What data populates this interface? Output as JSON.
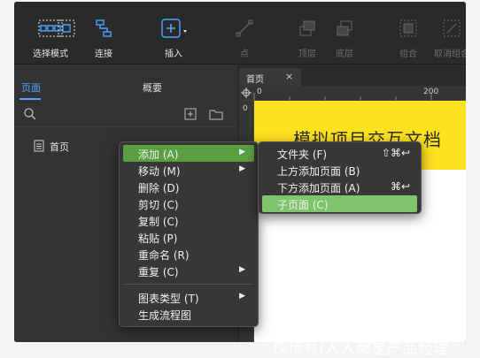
{
  "toolbar": {
    "select_mode": "选择模式",
    "connect": "连接",
    "insert": "插入",
    "point": "点",
    "top_layer": "顶层",
    "bottom_layer": "底层",
    "group": "组合",
    "ungroup": "取消组合"
  },
  "left_panel": {
    "tab_pages": "页面",
    "tab_overview": "概要",
    "page_item": "首页"
  },
  "canvas": {
    "tab_title": "首页",
    "tab_close": "×",
    "ruler_h_0": "0",
    "ruler_h_200": "200",
    "ruler_v_0": "0",
    "banner_title": "模拟项目交互文档"
  },
  "context_menu": {
    "items": [
      {
        "label": "添加 (A)"
      },
      {
        "label": "移动 (M)"
      },
      {
        "label": "删除 (D)"
      },
      {
        "label": "剪切 (C)"
      },
      {
        "label": "复制 (C)"
      },
      {
        "label": "粘贴 (P)"
      },
      {
        "label": "重命名 (R)"
      },
      {
        "label": "重复 (C)"
      },
      {
        "label": "图表类型 (T)"
      },
      {
        "label": "生成流程图"
      }
    ],
    "arrow": "▶"
  },
  "submenu": {
    "items": [
      {
        "label": "文件夹 (F)",
        "shortcut": "⇧⌘↩"
      },
      {
        "label": "上方添加页面 (B)",
        "shortcut": ""
      },
      {
        "label": "下方添加页面 (A)",
        "shortcut": "⌘↩"
      },
      {
        "label": "子页面 (C)",
        "shortcut": ""
      }
    ]
  },
  "watermark": "快传号/人人都是产品经理",
  "colors": {
    "accent_blue": "#4ea4ff",
    "highlight_green": "#5aa043",
    "highlight_light_green": "#7fc46c",
    "banner_yellow": "#ffe21e"
  }
}
